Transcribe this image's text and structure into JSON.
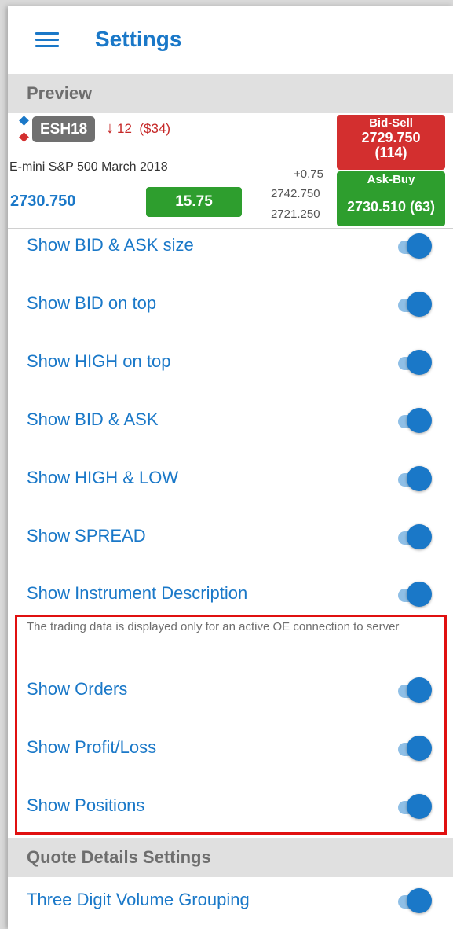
{
  "header": {
    "title": "Settings"
  },
  "sections": {
    "preview": "Preview",
    "quote_details": "Quote Details Settings"
  },
  "preview": {
    "symbol": "ESH18",
    "change_arrow": "↓",
    "change_ticks": "12",
    "change_value": "($34)",
    "description": "E-mini S&P 500  March 2018",
    "last_price": "2730.750",
    "spread": "15.75",
    "net_change": "+0.75",
    "high": "2742.750",
    "low": "2721.250",
    "bid_label": "Bid-Sell",
    "bid_price": "2729.750",
    "bid_size": "(114)",
    "ask_label": "Ask-Buy",
    "ask_price_size": "2730.510 (63)"
  },
  "settings": [
    {
      "label": "Show BID & ASK size",
      "enabled": true
    },
    {
      "label": "Show BID on top",
      "enabled": true
    },
    {
      "label": "Show HIGH on top",
      "enabled": true
    },
    {
      "label": "Show BID & ASK",
      "enabled": true
    },
    {
      "label": "Show HIGH & LOW",
      "enabled": true
    },
    {
      "label": "Show SPREAD",
      "enabled": true
    },
    {
      "label": "Show Instrument Description",
      "enabled": true
    }
  ],
  "trading": {
    "note": "The trading data is displayed only for an active OE connection to server",
    "items": [
      {
        "label": "Show Orders",
        "enabled": true
      },
      {
        "label": "Show Profit/Loss",
        "enabled": true
      },
      {
        "label": "Show Positions",
        "enabled": true
      }
    ]
  },
  "quote_details": {
    "items": [
      {
        "label": "Three Digit Volume Grouping",
        "enabled": true
      }
    ]
  },
  "colors": {
    "accent": "#1a78c8",
    "toggle_track": "#8fbfe6",
    "bid": "#d32f2f",
    "ask": "#2e9e2e",
    "highlight": "#e01010"
  }
}
